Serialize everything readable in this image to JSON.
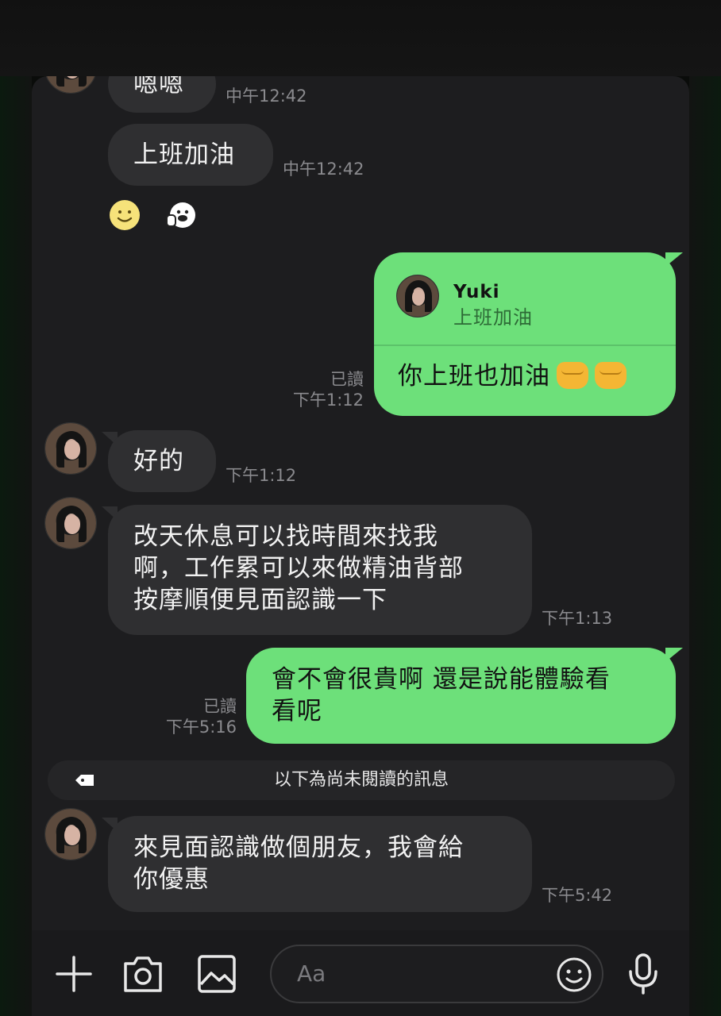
{
  "colors": {
    "incoming_bubble": "#2f2f31",
    "outgoing_bubble": "#6de07a",
    "background": "#1d1d1f",
    "meta_text": "#8a8a8e"
  },
  "messages": [
    {
      "text": "嗯嗯",
      "time": "中午12:42"
    },
    {
      "text": "上班加油",
      "time": "中午12:42"
    },
    {
      "reply": {
        "name": "Yuki",
        "quote": "上班加油",
        "text": "你上班也加油"
      },
      "read": "已讀",
      "time": "下午1:12"
    },
    {
      "text": "好的",
      "time": "下午1:12"
    },
    {
      "lines": [
        "改天休息可以找時間來找我",
        "啊，工作累可以來做精油背部",
        "按摩順便見面認識一下"
      ],
      "time": "下午1:13"
    },
    {
      "lines": [
        "會不會很貴啊 還是說能體驗看",
        "看呢"
      ],
      "read": "已讀",
      "time": "下午5:16"
    },
    {
      "lines": [
        "來見面認識做個朋友，我會給",
        "你優惠"
      ],
      "time": "下午5:42"
    }
  ],
  "unread_divider": "以下為尚未閱讀的訊息",
  "reactions": [
    "smile-emoji",
    "sticker-face"
  ],
  "input": {
    "placeholder": "Aa"
  },
  "icons": [
    "plus-icon",
    "camera-icon",
    "image-icon",
    "emoji-icon",
    "mic-icon"
  ]
}
